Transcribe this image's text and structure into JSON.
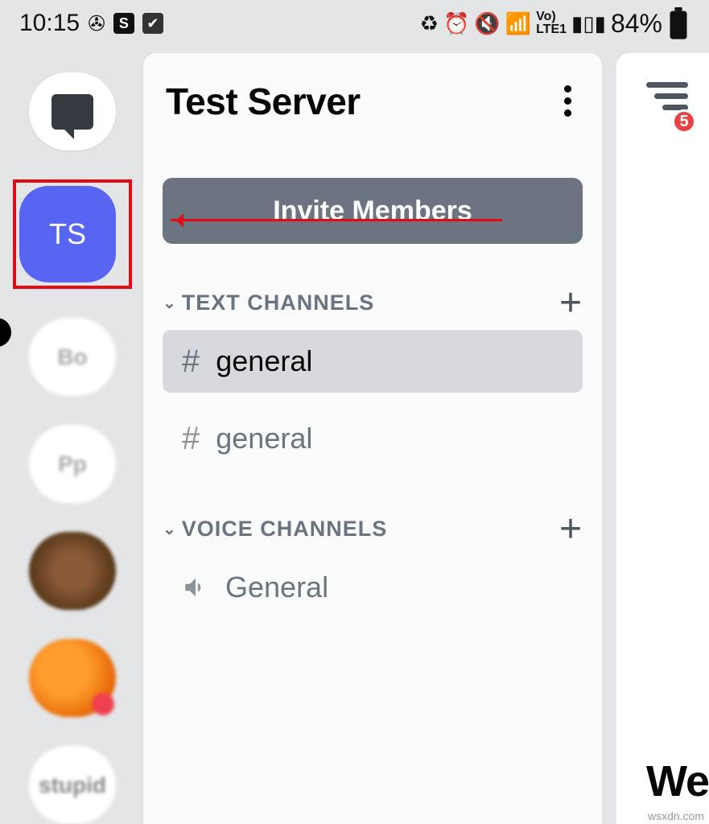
{
  "status": {
    "time": "10:15",
    "battery_pct": "84%",
    "lte_label": "LTE1",
    "vo_label": "Vo)"
  },
  "server_list": {
    "selected_server_abbr": "TS"
  },
  "panel": {
    "title": "Test Server",
    "invite_label": "Invite Members",
    "categories": {
      "text": {
        "label": "TEXT CHANNELS",
        "channels": [
          {
            "name": "general"
          },
          {
            "name": "general"
          }
        ]
      },
      "voice": {
        "label": "VOICE CHANNELS",
        "channels": [
          {
            "name": "General"
          }
        ]
      }
    }
  },
  "right": {
    "badge_count": "5",
    "peek_text": "We"
  },
  "watermark": "wsxdn.com"
}
